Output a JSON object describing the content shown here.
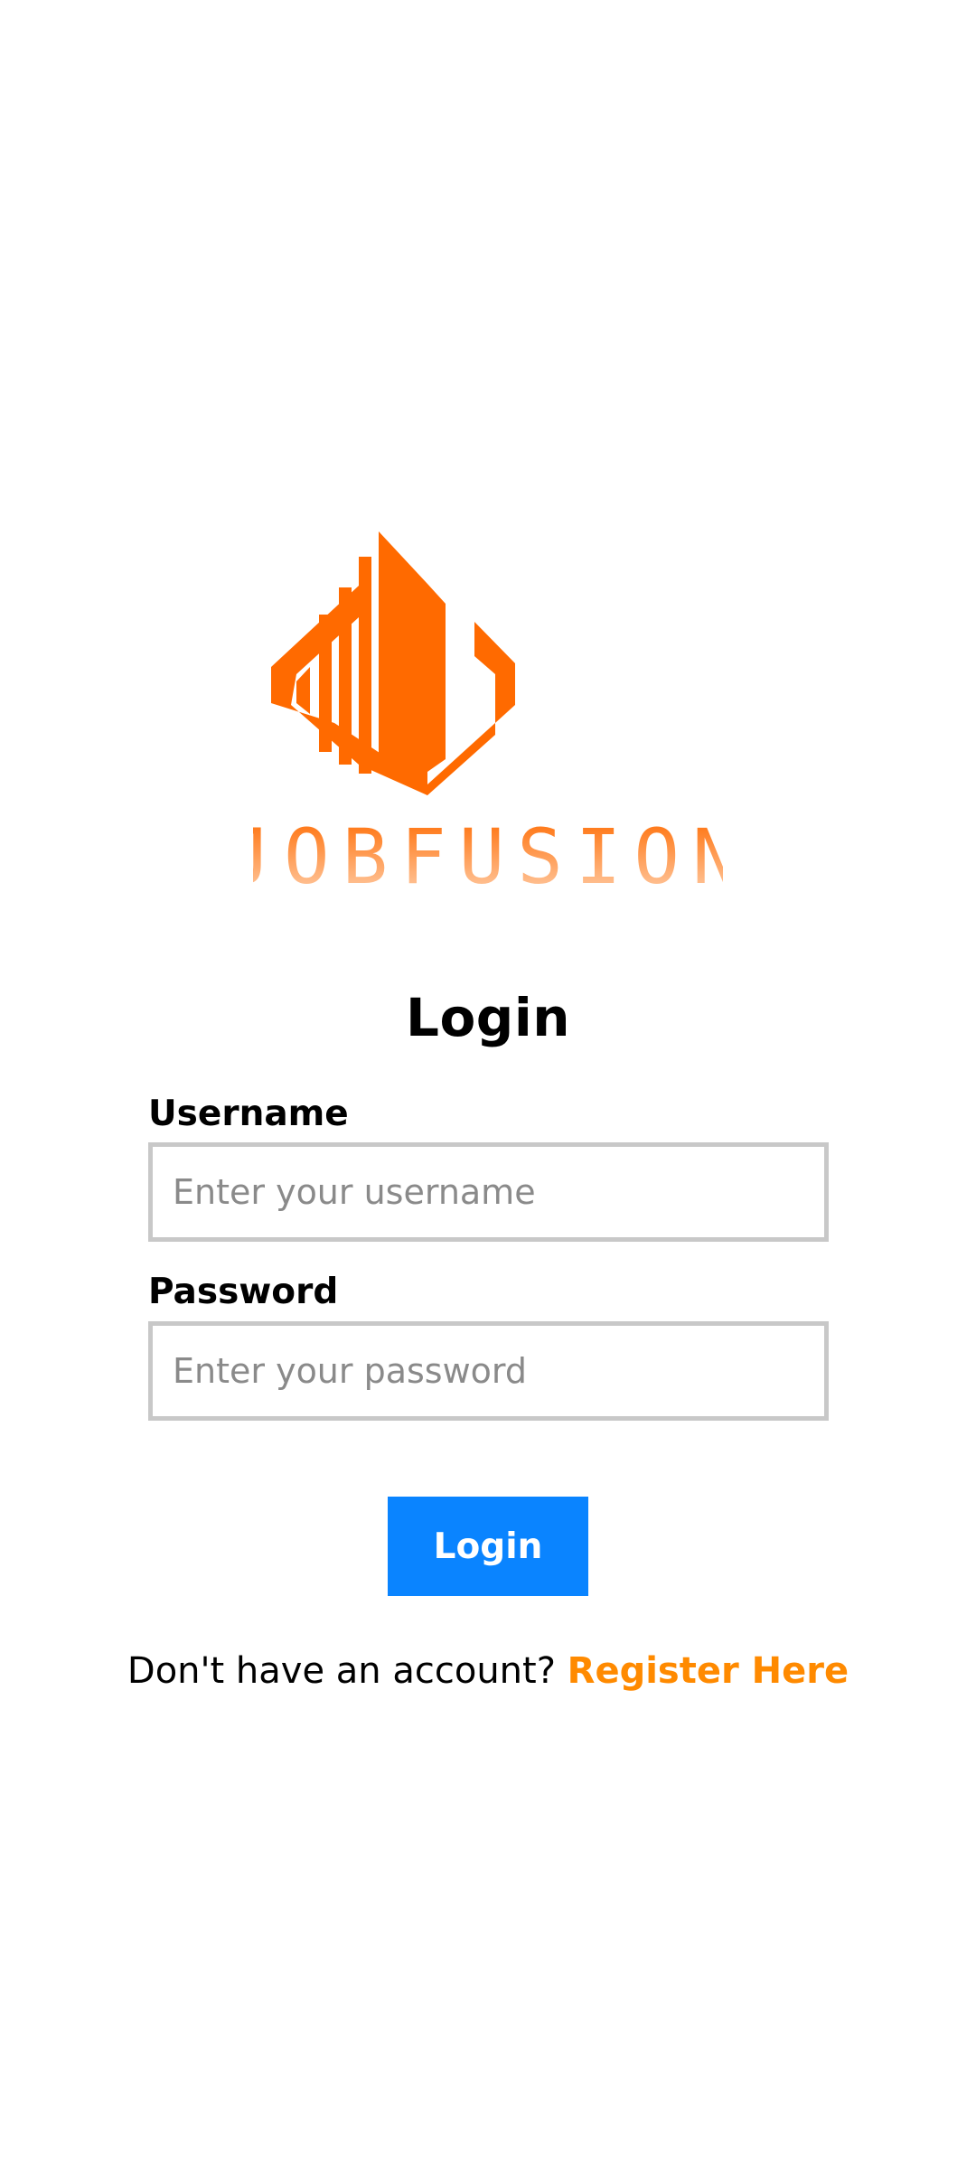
{
  "brand": {
    "name": "JOBFUSION",
    "logo_icon": "building-diamond-logo-icon",
    "primary_color": "#ff6a00"
  },
  "form": {
    "title": "Login",
    "username": {
      "label": "Username",
      "placeholder": "Enter your username",
      "value": ""
    },
    "password": {
      "label": "Password",
      "placeholder": "Enter your password",
      "value": ""
    },
    "submit_label": "Login",
    "submit_color": "#0a84ff"
  },
  "register": {
    "prompt": "Don't have an account?",
    "link_label": "Register Here",
    "link_color": "#ff8a00"
  }
}
